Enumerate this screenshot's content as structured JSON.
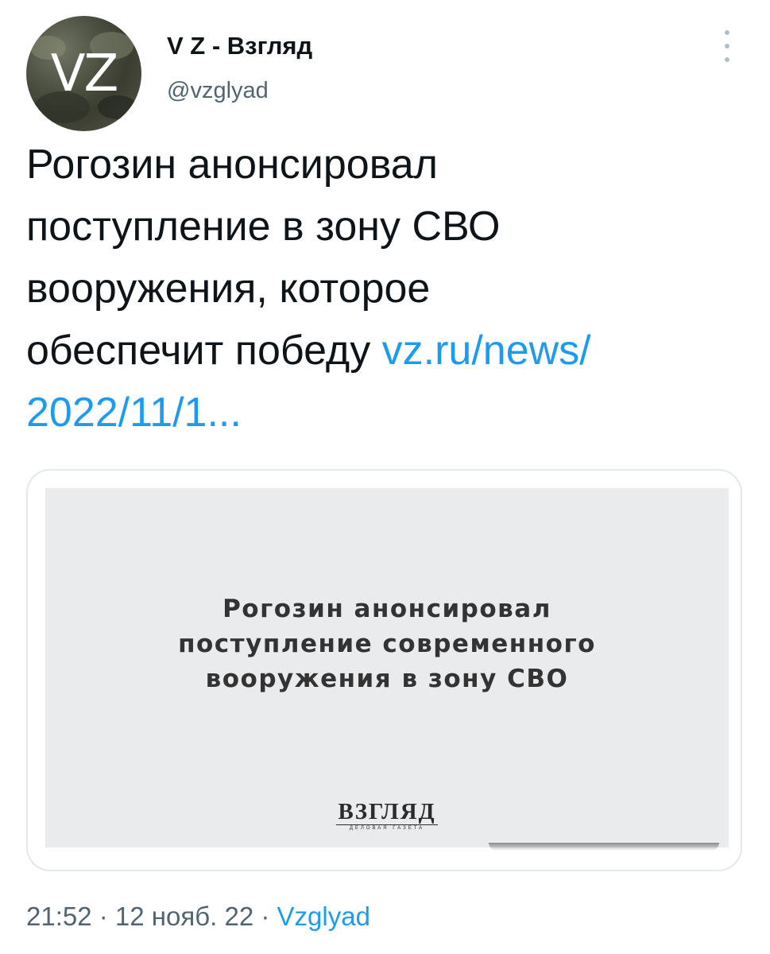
{
  "author": {
    "avatar_text": "VZ",
    "name": "V Z - Взгляд",
    "handle": "@vzglyad"
  },
  "more_icon": "more-vertical-icon",
  "tweet": {
    "lines": [
      "Рогозин анонсировал",
      "поступление в зону СВО",
      "вооружения, которое",
      "обеспечит победу "
    ],
    "link_part1": "vz.ru/news/",
    "link_part2": "2022/11/1..."
  },
  "card": {
    "headline": [
      "Рогозин анонсировал",
      "поступление современного",
      "вооружения в зону СВО"
    ],
    "brand": "ВЗГЛЯД",
    "brand_sub": "ДЕЛОВАЯ ГАЗЕТА"
  },
  "meta": {
    "time": "21:52",
    "sep1": " · ",
    "date": "12 нояб. 22",
    "sep2": " · ",
    "source": "Vzglyad"
  },
  "colors": {
    "link": "#1d9bf0",
    "secondary_text": "#536471",
    "primary_text": "#0f1419",
    "card_bg": "#eaebed"
  }
}
